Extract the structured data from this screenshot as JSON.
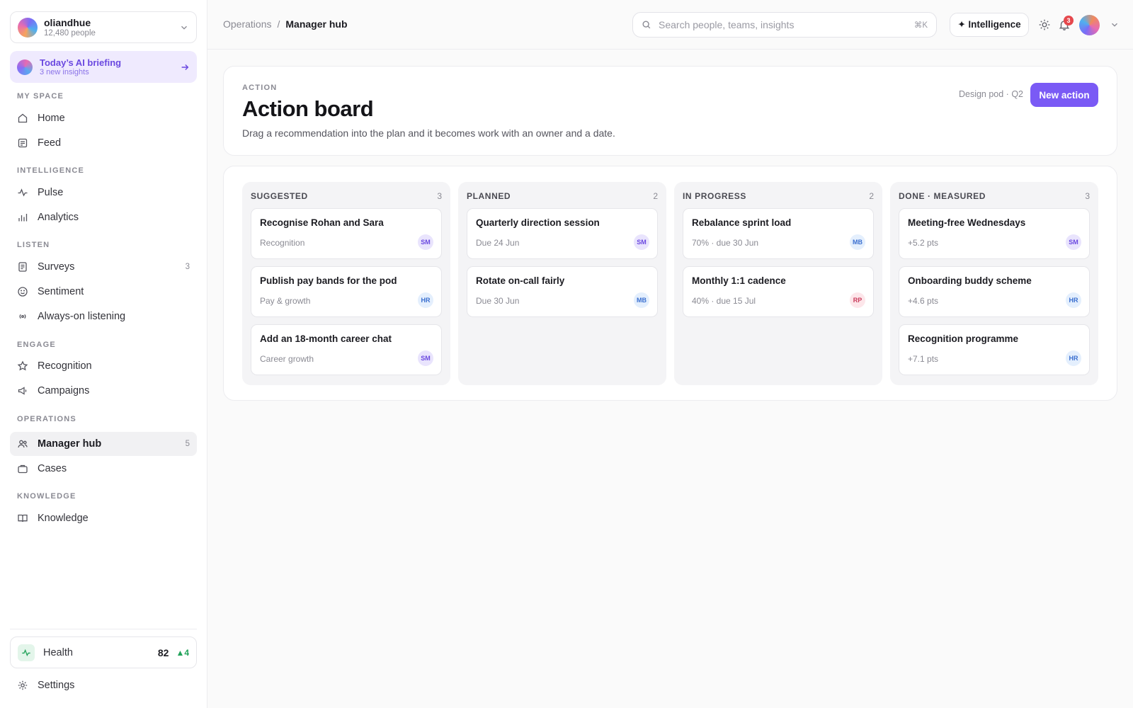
{
  "org": {
    "name": "oliandhue",
    "people": "12,480 people"
  },
  "briefing": {
    "title": "Today’s AI briefing",
    "subtitle": "3 new insights"
  },
  "sidebar": {
    "sections": {
      "my_space": "MY SPACE",
      "intelligence": "INTELLIGENCE",
      "listen": "LISTEN",
      "engage": "ENGAGE",
      "operations": "OPERATIONS",
      "knowledge": "KNOWLEDGE"
    },
    "items": {
      "home": "Home",
      "feed": "Feed",
      "pulse": "Pulse",
      "analytics": "Analytics",
      "surveys": "Surveys",
      "surveys_count": "3",
      "sentiment": "Sentiment",
      "listening": "Always-on listening",
      "recognition": "Recognition",
      "campaigns": "Campaigns",
      "manager_hub": "Manager hub",
      "manager_hub_count": "5",
      "cases": "Cases",
      "knowledge": "Knowledge"
    },
    "health": {
      "label": "Health",
      "score": "82",
      "delta": "▲4"
    },
    "settings": "Settings"
  },
  "topbar": {
    "breadcrumb_parent": "Operations",
    "breadcrumb_sep": "/",
    "breadcrumb_current": "Manager hub",
    "search_placeholder": "Search people, teams, insights",
    "search_shortcut": "⌘K",
    "intelligence_label": "✦ Intelligence",
    "notification_count": "3"
  },
  "header": {
    "eyebrow": "ACTION",
    "title": "Action board",
    "subtitle": "Drag a recommendation into the plan and it becomes work with an owner and a date.",
    "scope": "Design pod · Q2",
    "new_button": "New action"
  },
  "board": {
    "columns": [
      {
        "title": "SUGGESTED",
        "count": "3",
        "cards": [
          {
            "title": "Recognise Rohan and Sara",
            "meta": "Recognition",
            "owner": "SM"
          },
          {
            "title": "Publish pay bands for the pod",
            "meta": "Pay & growth",
            "owner": "HR"
          },
          {
            "title": "Add an 18-month career chat",
            "meta": "Career growth",
            "owner": "SM"
          }
        ]
      },
      {
        "title": "PLANNED",
        "count": "2",
        "cards": [
          {
            "title": "Quarterly direction session",
            "meta": "Due 24 Jun",
            "owner": "SM"
          },
          {
            "title": "Rotate on-call fairly",
            "meta": "Due 30 Jun",
            "owner": "MB"
          }
        ]
      },
      {
        "title": "IN PROGRESS",
        "count": "2",
        "cards": [
          {
            "title": "Rebalance sprint load",
            "meta": "70% · due 30 Jun",
            "owner": "MB"
          },
          {
            "title": "Monthly 1:1 cadence",
            "meta": "40% · due 15 Jul",
            "owner": "RP"
          }
        ]
      },
      {
        "title": "DONE · MEASURED",
        "count": "3",
        "cards": [
          {
            "title": "Meeting-free Wednesdays",
            "meta": "+5.2 pts",
            "owner": "SM"
          },
          {
            "title": "Onboarding buddy scheme",
            "meta": "+4.6 pts",
            "owner": "HR"
          },
          {
            "title": "Recognition programme",
            "meta": "+7.1 pts",
            "owner": "HR"
          }
        ]
      }
    ]
  }
}
